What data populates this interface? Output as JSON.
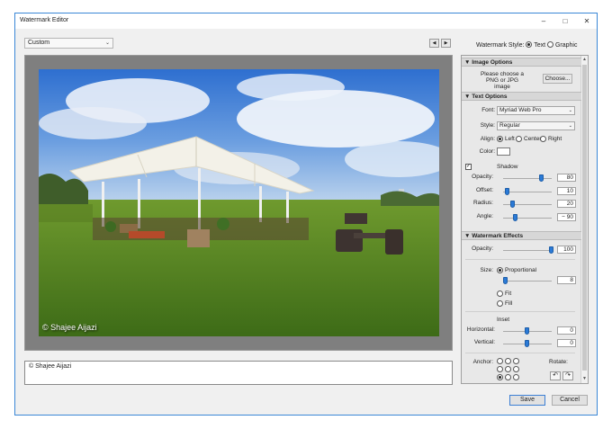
{
  "window": {
    "title": "Watermark Editor"
  },
  "window_controls": {
    "minimize": "–",
    "maximize": "□",
    "close": "✕"
  },
  "preset": {
    "value": "Custom"
  },
  "nav": {
    "prev": "◀",
    "next": "▶"
  },
  "preview": {
    "watermark_text": "© Shajee Aijazi"
  },
  "text_input": {
    "value": "© Shajee Aijazi"
  },
  "watermark_style": {
    "label": "Watermark Style:",
    "option_text": "Text",
    "option_graphic": "Graphic",
    "selected": "Text"
  },
  "image_options": {
    "header": "Image Options",
    "prompt": "Please choose a PNG or JPG image",
    "choose_button": "Choose..."
  },
  "text_options": {
    "header": "Text Options",
    "font_label": "Font:",
    "font_value": "Myriad Web Pro",
    "style_label": "Style:",
    "style_value": "Regular",
    "align_label": "Align:",
    "align_left": "Left",
    "align_center": "Center",
    "align_right": "Right",
    "align_selected": "Left",
    "color_label": "Color:",
    "color_value": "#ffffff",
    "shadow_label": "Shadow",
    "shadow_checked": true,
    "opacity_label": "Opacity:",
    "opacity_value": "80",
    "offset_label": "Offset:",
    "offset_value": "10",
    "radius_label": "Radius:",
    "radius_value": "20",
    "angle_label": "Angle:",
    "angle_value": "− 90"
  },
  "watermark_effects": {
    "header": "Watermark Effects",
    "opacity_label": "Opacity:",
    "opacity_value": "100",
    "size_label": "Size:",
    "size_proportional": "Proportional",
    "size_fit": "Fit",
    "size_fill": "Fill",
    "size_selected": "Proportional",
    "size_value": "8",
    "inset_label": "Inset",
    "horizontal_label": "Horizontal:",
    "horizontal_value": "0",
    "vertical_label": "Vertical:",
    "vertical_value": "0",
    "anchor_label": "Anchor:",
    "anchor_selected": "bottom-left",
    "rotate_label": "Rotate:"
  },
  "sliders": {
    "shadow_opacity": 0.8,
    "shadow_offset": 0.1,
    "shadow_radius": 0.2,
    "shadow_angle": 0.25,
    "effects_opacity": 1.0,
    "effects_size": 0.05,
    "inset_horizontal": 0.5,
    "inset_vertical": 0.5
  },
  "footer": {
    "save": "Save",
    "cancel": "Cancel"
  },
  "colors": {
    "accent": "#2b7ad6",
    "window_border": "#3a87d6"
  }
}
